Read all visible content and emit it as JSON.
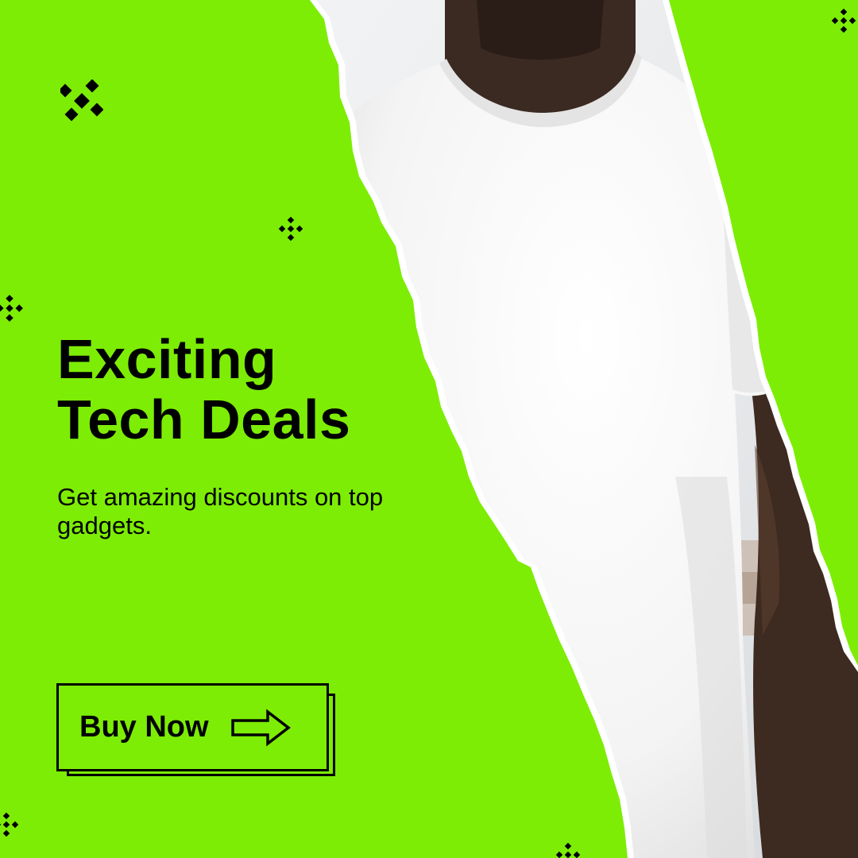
{
  "banner": {
    "headline_line1": "Exciting",
    "headline_line2": "Tech Deals",
    "subtext": "Get amazing discounts on top gadgets.",
    "cta_label": "Buy Now"
  },
  "colors": {
    "background": "#7ded05",
    "text": "#000000",
    "tear_edge": "#ffffff"
  },
  "icons": [
    "sparkle-icon",
    "pixel-cross-icon",
    "arrow-right-icon"
  ],
  "photo": {
    "subject": "person wearing a plain white t-shirt"
  }
}
